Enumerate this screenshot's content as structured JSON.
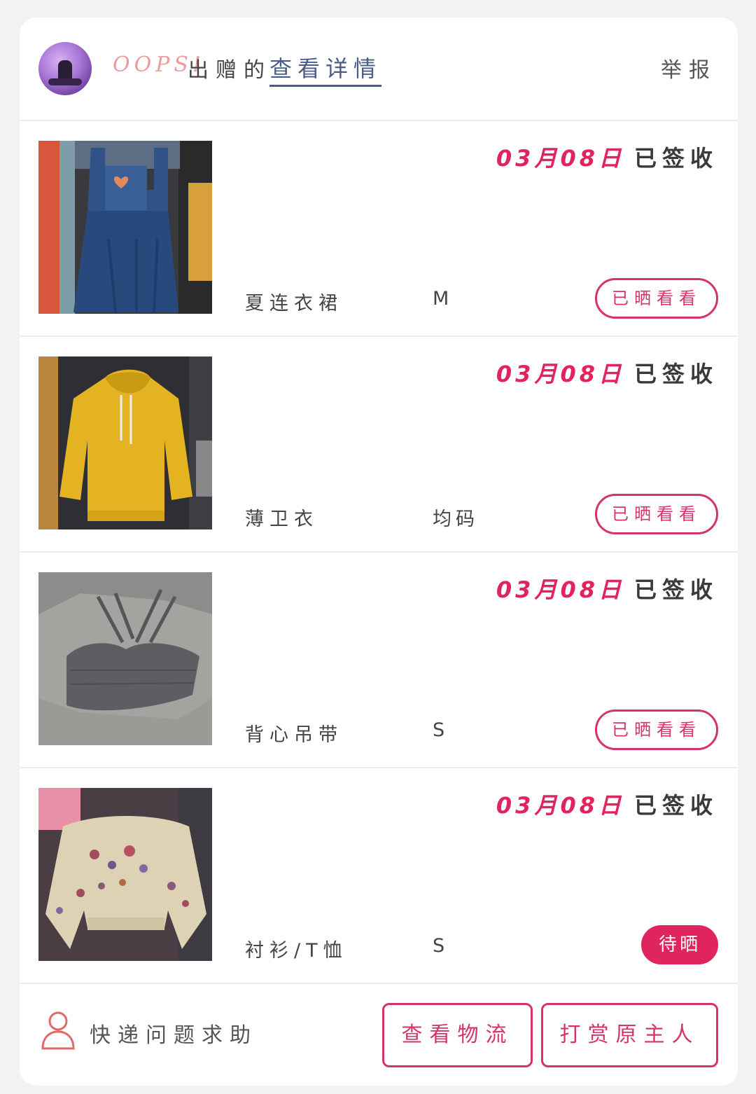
{
  "header": {
    "username": "OOPS!",
    "gift_text": "出赠的",
    "detail_link": "查看详情",
    "report": "举报"
  },
  "items": [
    {
      "date": "03月08日",
      "status": "已签收",
      "name": "夏连衣裙",
      "size": "M",
      "action": "已晒看看",
      "action_style": "outline"
    },
    {
      "date": "03月08日",
      "status": "已签收",
      "name": "薄卫衣",
      "size": "均码",
      "action": "已晒看看",
      "action_style": "outline"
    },
    {
      "date": "03月08日",
      "status": "已签收",
      "name": "背心吊带",
      "size": "S",
      "action": "已晒看看",
      "action_style": "outline"
    },
    {
      "date": "03月08日",
      "status": "已签收",
      "name": "衬衫/T恤",
      "size": "S",
      "action": "待晒",
      "action_style": "filled"
    }
  ],
  "footer": {
    "help_text": "快递问题求助",
    "logistics_button": "查看物流",
    "reward_button": "打赏原主人"
  },
  "icons": {
    "help": "person-outline-icon"
  },
  "colors": {
    "accent": "#e0245e",
    "link": "#4b5d86",
    "username": "#eb9c9c"
  }
}
